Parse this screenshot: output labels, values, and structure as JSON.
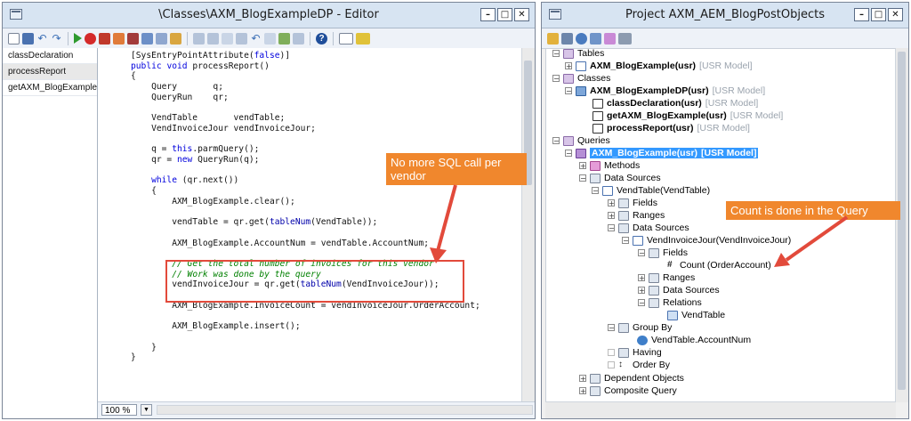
{
  "editor": {
    "title": "\\Classes\\AXM_BlogExampleDP - Editor",
    "methods": [
      "classDeclaration",
      "processReport",
      "getAXM_BlogExample"
    ],
    "selected_method": "processReport",
    "zoom": "100 %"
  },
  "project": {
    "title": "Project AXM_AEM_BlogPostObjects",
    "tree": {
      "tables": "Tables",
      "table_item": "AXM_BlogExample(usr)",
      "classes": "Classes",
      "class_item": "AXM_BlogExampleDP(usr)",
      "class_methods": [
        "classDeclaration(usr)",
        "getAXM_BlogExample(usr)",
        "processReport(usr)"
      ],
      "queries": "Queries",
      "query_item": "AXM_BlogExample(usr)",
      "query_model": "[USR Model]",
      "methods": "Methods",
      "data_sources": "Data Sources",
      "vendtable": "VendTable(VendTable)",
      "fields": "Fields",
      "ranges": "Ranges",
      "vendinvoicejour": "VendInvoiceJour(VendInvoiceJour)",
      "count_field": "Count (OrderAccount)",
      "relations": "Relations",
      "relation_item": "VendTable",
      "group_by": "Group By",
      "group_by_field": "VendTable.AccountNum",
      "having": "Having",
      "order_by": "Order By",
      "dependent_objects": "Dependent Objects",
      "composite_query": "Composite Query"
    },
    "model_label": "[USR Model]"
  },
  "annotations": {
    "callout_editor": "No more SQL call per vendor",
    "callout_project": "Count is done in the Query"
  },
  "colors": {
    "callout": "#f0872d",
    "box": "#e24a3b",
    "selection": "#3399ff"
  }
}
